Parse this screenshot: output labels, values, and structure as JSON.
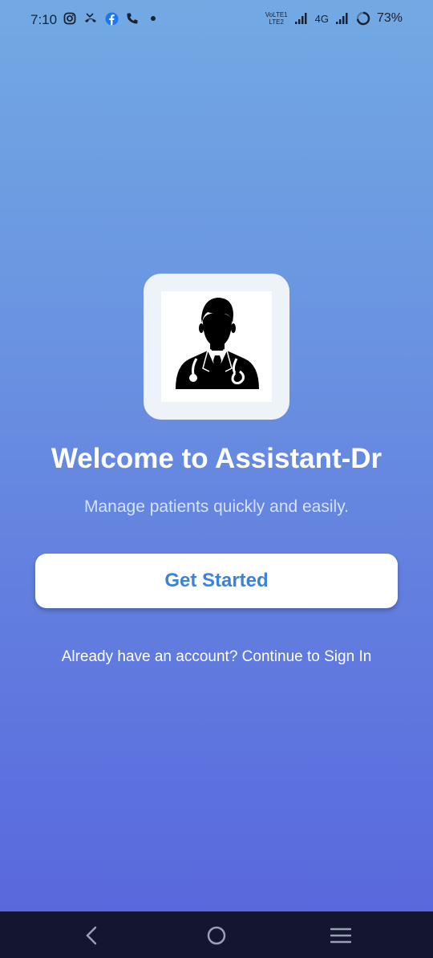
{
  "status_bar": {
    "time": "7:10",
    "volte_label_1": "VoLTE1",
    "volte_label_2": "LTE2",
    "network_label": "4G",
    "battery_percent": "73%",
    "icons_left": [
      "instagram-icon",
      "missed-call-icon",
      "facebook-icon",
      "phone-icon",
      "dot-icon"
    ]
  },
  "welcome": {
    "title": "Welcome to Assistant-Dr",
    "subtitle": "Manage patients quickly and easily.",
    "get_started_label": "Get Started",
    "signin_text": "Already have an account? Continue to Sign In"
  },
  "nav_bar": {
    "buttons": [
      "back",
      "home",
      "menu"
    ]
  },
  "colors": {
    "gradient_top": "#72A9E3",
    "gradient_bottom": "#5865DC",
    "button_text": "#3E82D6",
    "navbar_bg": "#14152F"
  }
}
